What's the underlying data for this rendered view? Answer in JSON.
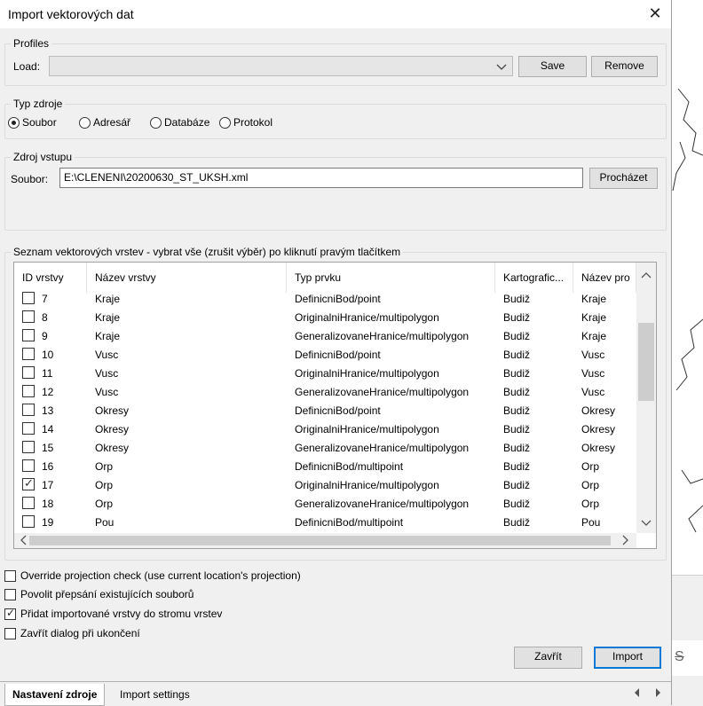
{
  "window": {
    "title": "Import vektorových dat",
    "close_glyph": "✕"
  },
  "profiles": {
    "group_label": "Profiles",
    "load_label": "Load:",
    "load_value": "",
    "save_label": "Save",
    "remove_label": "Remove"
  },
  "source_type": {
    "group_label": "Typ zdroje",
    "options": [
      "Soubor",
      "Adresář",
      "Databáze",
      "Protokol"
    ],
    "selected": "Soubor"
  },
  "input_source": {
    "group_label": "Zdroj vstupu",
    "file_label": "Soubor:",
    "file_value": "E:\\CLENENI\\20200630_ST_UKSH.xml",
    "browse_label": "Procházet"
  },
  "layers": {
    "group_label": "Seznam vektorových vrstev - vybrat vše (zrušit výběr) po kliknutí pravým tlačítkem",
    "columns": [
      "ID vrstvy",
      "Název vrstvy",
      "Typ prvku",
      "Kartografic...",
      "Název pro"
    ],
    "rows": [
      {
        "id": "7",
        "name": "Kraje",
        "type": "DefinicniBod/point",
        "carto": "Budiž",
        "out": "Kraje",
        "checked": false
      },
      {
        "id": "8",
        "name": "Kraje",
        "type": "OriginalniHranice/multipolygon",
        "carto": "Budiž",
        "out": "Kraje",
        "checked": false
      },
      {
        "id": "9",
        "name": "Kraje",
        "type": "GeneralizovaneHranice/multipolygon",
        "carto": "Budiž",
        "out": "Kraje",
        "checked": false
      },
      {
        "id": "10",
        "name": "Vusc",
        "type": "DefinicniBod/point",
        "carto": "Budiž",
        "out": "Vusc",
        "checked": false
      },
      {
        "id": "11",
        "name": "Vusc",
        "type": "OriginalniHranice/multipolygon",
        "carto": "Budiž",
        "out": "Vusc",
        "checked": false
      },
      {
        "id": "12",
        "name": "Vusc",
        "type": "GeneralizovaneHranice/multipolygon",
        "carto": "Budiž",
        "out": "Vusc",
        "checked": false
      },
      {
        "id": "13",
        "name": "Okresy",
        "type": "DefinicniBod/point",
        "carto": "Budiž",
        "out": "Okresy",
        "checked": false
      },
      {
        "id": "14",
        "name": "Okresy",
        "type": "OriginalniHranice/multipolygon",
        "carto": "Budiž",
        "out": "Okresy",
        "checked": false
      },
      {
        "id": "15",
        "name": "Okresy",
        "type": "GeneralizovaneHranice/multipolygon",
        "carto": "Budiž",
        "out": "Okresy",
        "checked": false
      },
      {
        "id": "16",
        "name": "Orp",
        "type": "DefinicniBod/multipoint",
        "carto": "Budiž",
        "out": "Orp",
        "checked": false
      },
      {
        "id": "17",
        "name": "Orp",
        "type": "OriginalniHranice/multipolygon",
        "carto": "Budiž",
        "out": "Orp",
        "checked": true
      },
      {
        "id": "18",
        "name": "Orp",
        "type": "GeneralizovaneHranice/multipolygon",
        "carto": "Budiž",
        "out": "Orp",
        "checked": false
      },
      {
        "id": "19",
        "name": "Pou",
        "type": "DefinicniBod/multipoint",
        "carto": "Budiž",
        "out": "Pou",
        "checked": false
      }
    ]
  },
  "options": {
    "override_projection": {
      "label": "Override projection check (use current location's projection)",
      "checked": false
    },
    "allow_overwrite": {
      "label": "Povolit přepsání existujících souborů",
      "checked": false
    },
    "add_to_tree": {
      "label": "Přidat importované vrstvy do stromu vrstev",
      "checked": true
    },
    "close_on_finish": {
      "label": "Zavřít dialog při ukončení",
      "checked": false
    }
  },
  "actions": {
    "close_label": "Zavřít",
    "import_label": "Import"
  },
  "tabs": {
    "items": [
      "Nastavení zdroje",
      "Import settings"
    ],
    "active": "Nastavení zdroje"
  },
  "background": {
    "strike_glyph": "S"
  },
  "colors": {
    "accent": "#0078d7",
    "dialog_bg": "#f0f0f0"
  }
}
